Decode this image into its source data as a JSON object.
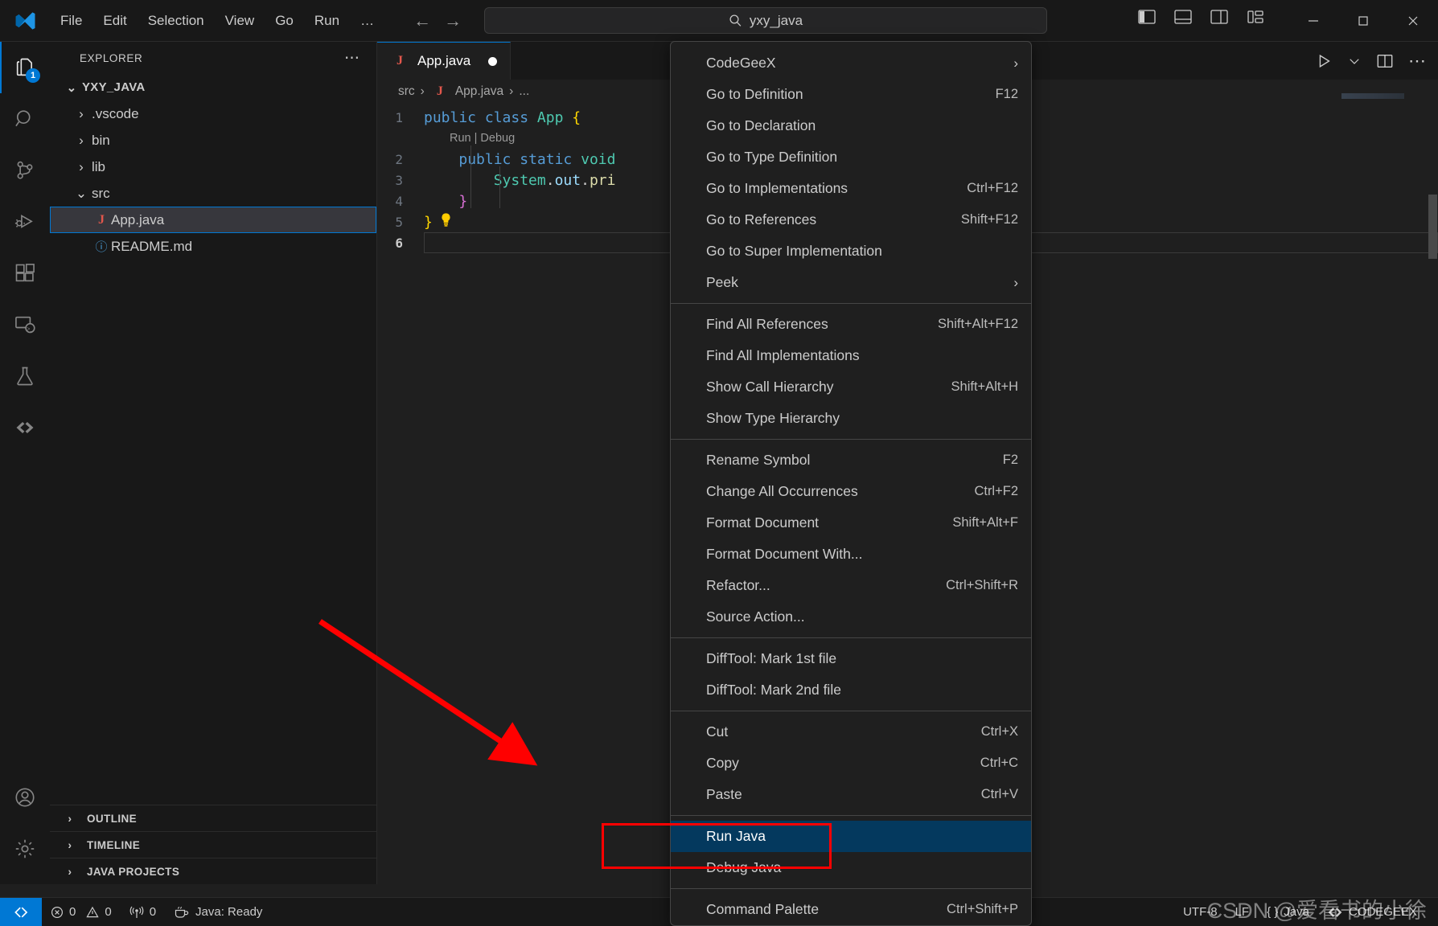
{
  "titlebar": {
    "logo_icon": "vscode-logo-icon",
    "menus": [
      "File",
      "Edit",
      "Selection",
      "View",
      "Go",
      "Run",
      "…"
    ],
    "nav_back_icon": "arrow-left-icon",
    "nav_forward_icon": "arrow-forward-icon",
    "search": {
      "icon": "search-icon",
      "value": "yxy_java",
      "placeholder": "Search"
    },
    "layout_icons": [
      "toggle-primary-sidebar-icon",
      "toggle-panel-icon",
      "toggle-secondary-sidebar-icon",
      "customize-layout-icon"
    ],
    "window_controls": [
      "minimize-icon",
      "maximize-icon",
      "close-icon"
    ]
  },
  "activitybar": {
    "items": [
      {
        "name": "explorer",
        "icon": "files-icon",
        "badge": "1",
        "active": true
      },
      {
        "name": "search",
        "icon": "search-icon",
        "badge": "",
        "active": false
      },
      {
        "name": "source-control",
        "icon": "source-control-icon",
        "badge": "",
        "active": false
      },
      {
        "name": "run-and-debug",
        "icon": "run-and-debug-icon",
        "badge": "",
        "active": false
      },
      {
        "name": "extensions",
        "icon": "extensions-icon",
        "badge": "",
        "active": false
      },
      {
        "name": "remote-explorer",
        "icon": "remote-explorer-icon",
        "badge": "",
        "active": false
      },
      {
        "name": "testing",
        "icon": "beaker-icon",
        "badge": "",
        "active": false
      },
      {
        "name": "codegeex",
        "icon": "codegeex-icon",
        "badge": "",
        "active": false
      }
    ],
    "bottom": [
      {
        "name": "accounts",
        "icon": "account-icon"
      },
      {
        "name": "manage",
        "icon": "gear-icon"
      }
    ]
  },
  "sidebar": {
    "title": "EXPLORER",
    "more_icon": "ellipsis-icon",
    "root": {
      "label": "YXY_JAVA",
      "expanded": true
    },
    "tree": [
      {
        "label": ".vscode",
        "type": "folder",
        "expanded": false,
        "icon": "chevron-right-icon",
        "indent": 1
      },
      {
        "label": "bin",
        "type": "folder",
        "expanded": false,
        "icon": "chevron-right-icon",
        "indent": 1
      },
      {
        "label": "lib",
        "type": "folder",
        "expanded": false,
        "icon": "chevron-right-icon",
        "indent": 1
      },
      {
        "label": "src",
        "type": "folder",
        "expanded": true,
        "icon": "chevron-down-icon",
        "indent": 1
      },
      {
        "label": "App.java",
        "type": "java-file",
        "icon": "java-file-icon",
        "indent": 2,
        "selected": true
      },
      {
        "label": "README.md",
        "type": "markdown-file",
        "icon": "markdown-file-icon",
        "indent": 1,
        "selected": false
      }
    ],
    "sections": [
      {
        "label": "OUTLINE",
        "icon": "chevron-right-icon"
      },
      {
        "label": "TIMELINE",
        "icon": "chevron-right-icon"
      },
      {
        "label": "JAVA PROJECTS",
        "icon": "chevron-right-icon"
      }
    ]
  },
  "editor": {
    "tab": {
      "label": "App.java",
      "icon": "java-file-icon",
      "dirty": true
    },
    "actions": [
      "run-icon",
      "chevron-down-icon",
      "split-editor-icon",
      "ellipsis-icon"
    ],
    "breadcrumb": [
      "src",
      "App.java",
      "..."
    ],
    "codelens": "Run | Debug",
    "lines": [
      {
        "n": "1",
        "tokens": [
          {
            "t": "public",
            "c": "k-blue"
          },
          {
            "t": " ",
            "c": ""
          },
          {
            "t": "class",
            "c": "k-blue"
          },
          {
            "t": " ",
            "c": ""
          },
          {
            "t": "App",
            "c": "k-green"
          },
          {
            "t": " ",
            "c": ""
          },
          {
            "t": "{",
            "c": "k-brace-y"
          }
        ]
      },
      {
        "n": "2",
        "tokens": [
          {
            "t": "    public",
            "c": "k-blue"
          },
          {
            "t": " ",
            "c": ""
          },
          {
            "t": "static",
            "c": "k-blue"
          },
          {
            "t": " ",
            "c": ""
          },
          {
            "t": "void",
            "c": "k-teal"
          }
        ]
      },
      {
        "n": "3",
        "tokens": [
          {
            "t": "        System",
            "c": "k-green"
          },
          {
            "t": ".",
            "c": ""
          },
          {
            "t": "out",
            "c": "k-lightblue"
          },
          {
            "t": ".",
            "c": ""
          },
          {
            "t": "pri",
            "c": "k-yellow"
          }
        ]
      },
      {
        "n": "4",
        "tokens": [
          {
            "t": "    }",
            "c": "k-brace-p"
          }
        ]
      },
      {
        "n": "5",
        "tokens": [
          {
            "t": "}",
            "c": "k-brace-y"
          }
        ],
        "bulb": true
      },
      {
        "n": "6",
        "tokens": [],
        "current": true
      }
    ]
  },
  "contextmenu": {
    "groups": [
      {
        "items": [
          {
            "label": "CodeGeeX",
            "key": "",
            "submenu": true
          },
          {
            "label": "Go to Definition",
            "key": "F12",
            "submenu": false
          },
          {
            "label": "Go to Declaration",
            "key": "",
            "submenu": false
          },
          {
            "label": "Go to Type Definition",
            "key": "",
            "submenu": false
          },
          {
            "label": "Go to Implementations",
            "key": "Ctrl+F12",
            "submenu": false
          },
          {
            "label": "Go to References",
            "key": "Shift+F12",
            "submenu": false
          },
          {
            "label": "Go to Super Implementation",
            "key": "",
            "submenu": false
          },
          {
            "label": "Peek",
            "key": "",
            "submenu": true
          }
        ]
      },
      {
        "items": [
          {
            "label": "Find All References",
            "key": "Shift+Alt+F12",
            "submenu": false
          },
          {
            "label": "Find All Implementations",
            "key": "",
            "submenu": false
          },
          {
            "label": "Show Call Hierarchy",
            "key": "Shift+Alt+H",
            "submenu": false
          },
          {
            "label": "Show Type Hierarchy",
            "key": "",
            "submenu": false
          }
        ]
      },
      {
        "items": [
          {
            "label": "Rename Symbol",
            "key": "F2",
            "submenu": false
          },
          {
            "label": "Change All Occurrences",
            "key": "Ctrl+F2",
            "submenu": false
          },
          {
            "label": "Format Document",
            "key": "Shift+Alt+F",
            "submenu": false
          },
          {
            "label": "Format Document With...",
            "key": "",
            "submenu": false
          },
          {
            "label": "Refactor...",
            "key": "Ctrl+Shift+R",
            "submenu": false
          },
          {
            "label": "Source Action...",
            "key": "",
            "submenu": false
          }
        ]
      },
      {
        "items": [
          {
            "label": "DiffTool: Mark 1st file",
            "key": "",
            "submenu": false
          },
          {
            "label": "DiffTool: Mark 2nd file",
            "key": "",
            "submenu": false
          }
        ]
      },
      {
        "items": [
          {
            "label": "Cut",
            "key": "Ctrl+X",
            "submenu": false
          },
          {
            "label": "Copy",
            "key": "Ctrl+C",
            "submenu": false
          },
          {
            "label": "Paste",
            "key": "Ctrl+V",
            "submenu": false
          }
        ]
      },
      {
        "items": [
          {
            "label": "Run Java",
            "key": "",
            "submenu": false,
            "highlight": true
          },
          {
            "label": "Debug Java",
            "key": "",
            "submenu": false
          }
        ]
      },
      {
        "items": [
          {
            "label": "Command Palette",
            "key": "Ctrl+Shift+P",
            "submenu": false
          }
        ]
      }
    ]
  },
  "annotations": {
    "red_box_target": "Run Java",
    "red_arrow": "pointer-arrow"
  },
  "statusbar": {
    "remote_icon": "remote-window-icon",
    "left": [
      {
        "name": "problems-errors",
        "icon": "error-icon",
        "label": "0"
      },
      {
        "name": "problems-warnings",
        "icon": "warning-icon",
        "label": "0"
      },
      {
        "name": "ports",
        "icon": "radio-tower-icon",
        "label": "0"
      },
      {
        "name": "java-status",
        "icon": "coffee-icon",
        "label": "Java: Ready"
      }
    ],
    "right": [
      {
        "name": "encoding",
        "icon": "",
        "label": "UTF-8"
      },
      {
        "name": "eol",
        "icon": "",
        "label": "LF"
      },
      {
        "name": "language-mode",
        "icon": "braces-icon",
        "label": "Java"
      },
      {
        "name": "codegeex",
        "icon": "codegeex-icon",
        "label": "CODEGEEX"
      }
    ]
  },
  "watermark": {
    "main": "CSDN @爱看书的小徐",
    "sub": ""
  },
  "colors": {
    "accent": "#0078d4",
    "menu_highlight": "#04395e",
    "annotation_red": "#ff0000",
    "java_red": "#e2574c",
    "titlebar_bg": "#181818",
    "editor_bg": "#1f1f1f"
  }
}
